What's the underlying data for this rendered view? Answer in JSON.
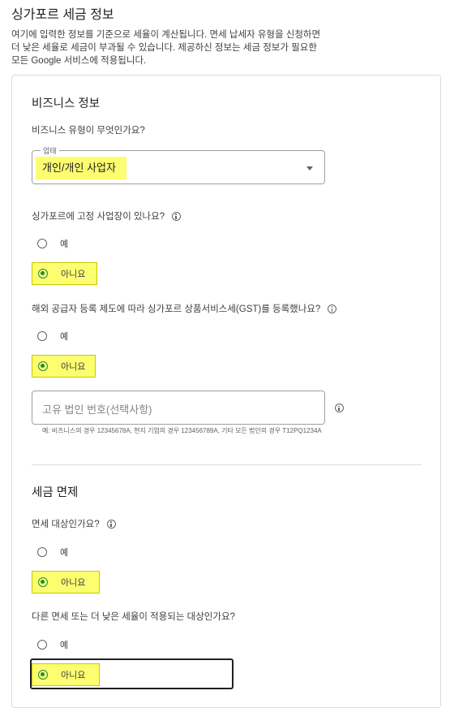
{
  "page": {
    "title": "싱가포르 세금 정보",
    "intro_lines": [
      "여기에 입력한 정보를 기준으로 세율이 계산됩니다. 면세 납세자 유형을 신청하면",
      "더 낮은 세율로 세금이 부과될 수 있습니다. 제공하신 정보는 세금 정보가 필요한",
      "모든 Google 서비스에 적용됩니다."
    ]
  },
  "business": {
    "heading": "비즈니스 정보",
    "type_question": "비즈니스 유형이 무엇인가요?",
    "select_legend": "업태",
    "select_value": "개인/개인 사업자",
    "fixed_place_question": "싱가포르에 고정 사업장이 있나요?",
    "fixed_place_options": [
      "예",
      "아니요"
    ],
    "gst_question": "해외 공급자 등록 제도에 따라 싱가포르 상품서비스세(GST)를 등록했나요?",
    "gst_options": [
      "예",
      "아니요"
    ],
    "uen_placeholder": "고유 법인 번호(선택사항)",
    "uen_helper": "예: 비즈니스의 경우 12345678A, 현지 기업의 경우 123456789A, 기타 모든 법인의 경우 T12PQ1234A"
  },
  "exemption": {
    "heading": "세금 면제",
    "exempt_question": "면세 대상인가요?",
    "exempt_options": [
      "예",
      "아니요"
    ],
    "reduced_question": "다른 면세 또는 더 낮은 세율이 적용되는 대상인가요?",
    "reduced_options": [
      "예",
      "아니요"
    ]
  },
  "colors": {
    "highlight": "#fdfd70",
    "radio_selected": "#1e8e3e"
  }
}
